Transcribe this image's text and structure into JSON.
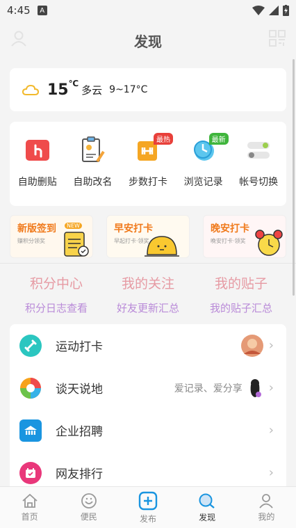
{
  "status": {
    "time": "4:45",
    "notify_letter": "A"
  },
  "header": {
    "title": "发现"
  },
  "weather": {
    "temp": "15",
    "unit": "℃",
    "condition": "多云",
    "range": "9~17°C"
  },
  "tools": [
    {
      "label": "自助删贴",
      "icon": "delete-post-icon"
    },
    {
      "label": "自助改名",
      "icon": "rename-icon"
    },
    {
      "label": "步数打卡",
      "icon": "steps-icon",
      "badge": "最热",
      "badge_color": "#e8403a"
    },
    {
      "label": "浏览记录",
      "icon": "history-icon",
      "badge": "最新",
      "badge_color": "#3fb53c"
    },
    {
      "label": "帐号切换",
      "icon": "account-switch-icon"
    }
  ],
  "checkins": [
    {
      "title": "新版签到",
      "sub": "赚积分领奖",
      "tag": "NEW"
    },
    {
      "title": "早安打卡",
      "sub": "早起打卡·领奖"
    },
    {
      "title": "晚安打卡",
      "sub": "晚安打卡·领奖"
    }
  ],
  "points": [
    {
      "title": "积分中心",
      "sub": "积分日志查看"
    },
    {
      "title": "我的关注",
      "sub": "好友更新汇总"
    },
    {
      "title": "我的贴子",
      "sub": "我的贴子汇总"
    }
  ],
  "list": [
    {
      "label": "运动打卡",
      "extra": "",
      "icon": "dumbbell-icon",
      "color": "#2bc6c0"
    },
    {
      "label": "谈天说地",
      "extra": "爱记录、爱分享",
      "icon": "aperture-icon",
      "color": "#f7a21b"
    },
    {
      "label": "企业招聘",
      "extra": "",
      "icon": "company-icon",
      "color": "#1a95e0"
    },
    {
      "label": "网友排行",
      "extra": "",
      "icon": "calendar-icon",
      "color": "#e9377a"
    }
  ],
  "tabs": [
    {
      "label": "首页",
      "icon": "home-icon"
    },
    {
      "label": "便民",
      "icon": "smile-icon"
    },
    {
      "label": "发布",
      "icon": "plus-icon"
    },
    {
      "label": "发现",
      "icon": "discover-icon"
    },
    {
      "label": "我的",
      "icon": "profile-icon"
    }
  ],
  "colors": {
    "accent": "#1a95e0",
    "pink": "#e69aa3",
    "purple": "#b98ad8",
    "orange": "#f07a1c"
  }
}
